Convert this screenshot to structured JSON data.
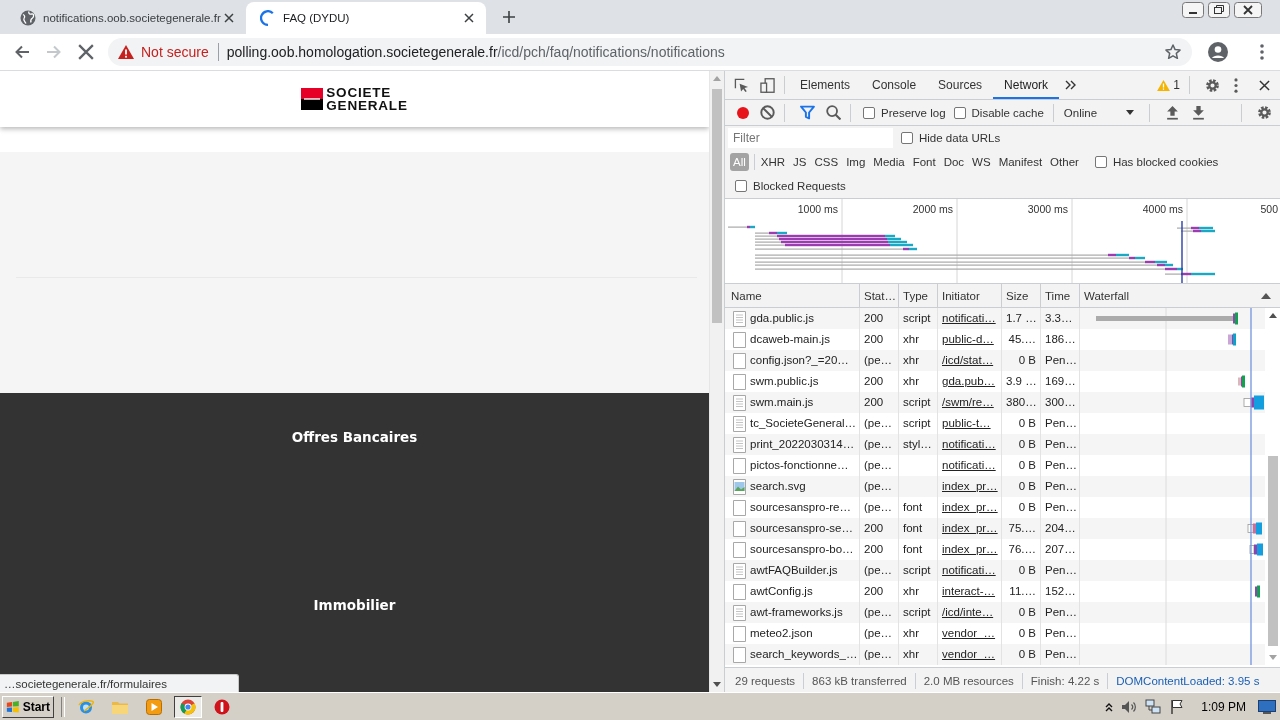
{
  "browser": {
    "tabs": [
      {
        "title": "notifications.oob.societegenerale.fr",
        "selected": false,
        "loading": false
      },
      {
        "title": "FAQ (DYDU)",
        "selected": true,
        "loading": true
      }
    ],
    "navigation": {
      "back_enabled": true,
      "forward_enabled": false,
      "loading": true
    },
    "address_bar": {
      "security": "Not secure",
      "host": "polling.oob.homologation.societegenerale.fr",
      "path": "/icd/pch/faq/notifications/notifications"
    }
  },
  "page": {
    "logo": [
      "SOCIETE",
      "GENERALE"
    ],
    "sections": [
      "Offres Bancaires",
      "Immobilier"
    ],
    "status_bubble": "…societegenerale.fr/formulaires"
  },
  "devtools": {
    "panels": [
      {
        "label": "Elements",
        "selected": false
      },
      {
        "label": "Console",
        "selected": false
      },
      {
        "label": "Sources",
        "selected": false
      },
      {
        "label": "Network",
        "selected": true
      }
    ],
    "warning_count": "1",
    "recording": true,
    "filter_open": true,
    "options": [
      {
        "label": "Preserve log",
        "checked": false
      },
      {
        "label": "Disable cache",
        "checked": false
      }
    ],
    "throttling": "Online",
    "filter": {
      "placeholder": "Filter"
    },
    "hide_data_urls": {
      "label": "Hide data URLs",
      "checked": false
    },
    "resource_types": [
      {
        "label": "All",
        "selected": true
      },
      {
        "label": "XHR",
        "selected": false
      },
      {
        "label": "JS",
        "selected": false
      },
      {
        "label": "CSS",
        "selected": false
      },
      {
        "label": "Img",
        "selected": false
      },
      {
        "label": "Media",
        "selected": false
      },
      {
        "label": "Font",
        "selected": false
      },
      {
        "label": "Doc",
        "selected": false
      },
      {
        "label": "WS",
        "selected": false
      },
      {
        "label": "Manifest",
        "selected": false
      },
      {
        "label": "Other",
        "selected": false
      }
    ],
    "has_blocked_cookies": {
      "label": "Has blocked cookies",
      "checked": false
    },
    "blocked_requests": {
      "label": "Blocked Requests",
      "checked": false
    },
    "overview_ticks": [
      "1000 ms",
      "2000 ms",
      "3000 ms",
      "4000 ms",
      "500"
    ],
    "columns": [
      {
        "label": "Name",
        "sorted": false
      },
      {
        "label": "Stat…",
        "sorted": false
      },
      {
        "label": "Type",
        "sorted": false
      },
      {
        "label": "Initiator",
        "sorted": false
      },
      {
        "label": "Size",
        "sorted": false
      },
      {
        "label": "Time",
        "sorted": false
      },
      {
        "label": "Waterfall",
        "sorted": true
      }
    ],
    "requests": [
      {
        "name": "gda.public.js",
        "kind": "document",
        "status": "200",
        "type": "script",
        "initiator": "notificati…",
        "size": "1.7 …",
        "time": "3.3…"
      },
      {
        "name": "dcaweb-main.js",
        "kind": "file",
        "status": "200",
        "type": "xhr",
        "initiator": "public-d…",
        "size": "45.…",
        "time": "186…"
      },
      {
        "name": "config.json?_=20…",
        "kind": "file",
        "status": "(pe…",
        "type": "xhr",
        "initiator": "/icd/stat…",
        "size": "0 B",
        "time": "Pen…"
      },
      {
        "name": "swm.public.js",
        "kind": "file",
        "status": "200",
        "type": "xhr",
        "initiator": "gda.pub…",
        "size": "3.9 …",
        "time": "169…"
      },
      {
        "name": "swm.main.js",
        "kind": "document",
        "status": "200",
        "type": "script",
        "initiator": "/swm/re…",
        "size": "380…",
        "time": "300…"
      },
      {
        "name": "tc_SocieteGeneral…",
        "kind": "document",
        "status": "(pe…",
        "type": "script",
        "initiator": "public-t…",
        "size": "0 B",
        "time": "Pen…"
      },
      {
        "name": "print_2022030314…",
        "kind": "document",
        "status": "(pe…",
        "type": "styl…",
        "initiator": "notificati…",
        "size": "0 B",
        "time": "Pen…"
      },
      {
        "name": "pictos-fonctionne…",
        "kind": "file",
        "status": "(pe…",
        "initiator": "notificati…",
        "size": "0 B",
        "time": "Pen…"
      },
      {
        "name": "search.svg",
        "kind": "image",
        "status": "(pe…",
        "initiator": "index_pr…",
        "size": "0 B",
        "time": "Pen…"
      },
      {
        "name": "sourcesanspro-re…",
        "kind": "file",
        "status": "(pe…",
        "type": "font",
        "initiator": "index_pr…",
        "size": "0 B",
        "time": "Pen…"
      },
      {
        "name": "sourcesanspro-se…",
        "kind": "file",
        "status": "200",
        "type": "font",
        "initiator": "index_pr…",
        "size": "75.…",
        "time": "204…"
      },
      {
        "name": "sourcesanspro-bo…",
        "kind": "file",
        "status": "200",
        "type": "font",
        "initiator": "index_pr…",
        "size": "76.…",
        "time": "207…"
      },
      {
        "name": "awtFAQBuilder.js",
        "kind": "document",
        "status": "(pe…",
        "type": "script",
        "initiator": "notificati…",
        "size": "0 B",
        "time": "Pen…"
      },
      {
        "name": "awtConfig.js",
        "kind": "file",
        "status": "200",
        "type": "xhr",
        "initiator": "interact-…",
        "size": "11.…",
        "time": "152…"
      },
      {
        "name": "awt-frameworks.js",
        "kind": "document",
        "status": "(pe…",
        "type": "script",
        "initiator": "/icd/inte…",
        "size": "0 B",
        "time": "Pen…"
      },
      {
        "name": "meteo2.json",
        "kind": "file",
        "status": "(pe…",
        "type": "xhr",
        "initiator": "vendor_…",
        "size": "0 B",
        "time": "Pen…"
      },
      {
        "name": "search_keywords_…",
        "kind": "file",
        "status": "(pe…",
        "type": "xhr",
        "initiator": "vendor_…",
        "size": "0 B",
        "time": "Pen…"
      }
    ],
    "summary": {
      "requests": "29 requests",
      "transferred": "863 kB transferred",
      "resources": "2.0 MB resources",
      "finish": "Finish: 4.22 s",
      "dom_content_loaded": "DOMContentLoaded: 3.95 s"
    }
  },
  "taskbar": {
    "start": "Start",
    "apps": [
      {
        "kind": "web",
        "selected": false
      },
      {
        "kind": "files",
        "selected": false
      },
      {
        "kind": "media",
        "selected": false
      },
      {
        "kind": "browser",
        "selected": true
      },
      {
        "kind": "security",
        "selected": false
      }
    ],
    "clock": "1:09 PM"
  }
}
